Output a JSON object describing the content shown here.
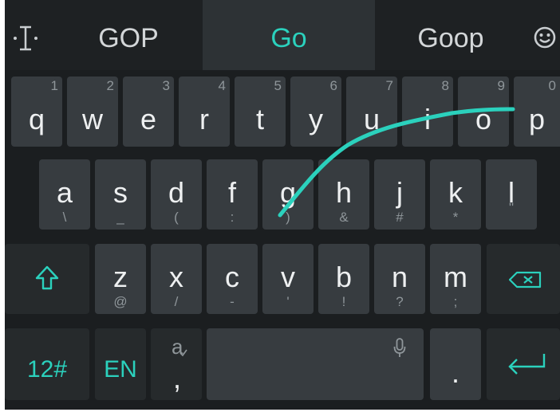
{
  "suggestions": {
    "left": "GOP",
    "center": "Go",
    "right": "Goop"
  },
  "accent_color": "#2bd1bd",
  "icons": {
    "cursor": "text-cursor-icon",
    "emoji": "emoji-icon",
    "shift": "shift-arrow-icon",
    "backspace": "backspace-icon",
    "mic": "microphone-icon",
    "enter": "enter-arrow-icon"
  },
  "rows": {
    "top": [
      {
        "main": "q",
        "hint": "1"
      },
      {
        "main": "w",
        "hint": "2"
      },
      {
        "main": "e",
        "hint": "3"
      },
      {
        "main": "r",
        "hint": "4"
      },
      {
        "main": "t",
        "hint": "5"
      },
      {
        "main": "y",
        "hint": "6"
      },
      {
        "main": "u",
        "hint": "7"
      },
      {
        "main": "i",
        "hint": "8"
      },
      {
        "main": "o",
        "hint": "9"
      },
      {
        "main": "p",
        "hint": "0"
      }
    ],
    "home": [
      {
        "main": "a",
        "hint": "\\"
      },
      {
        "main": "s",
        "hint": "_"
      },
      {
        "main": "d",
        "hint": "("
      },
      {
        "main": "f",
        "hint": ":"
      },
      {
        "main": "g",
        "hint": ")"
      },
      {
        "main": "h",
        "hint": "&"
      },
      {
        "main": "j",
        "hint": "#"
      },
      {
        "main": "k",
        "hint": "*"
      },
      {
        "main": "l",
        "hint": "\""
      }
    ],
    "bottom": [
      {
        "main": "z",
        "hint": "@"
      },
      {
        "main": "x",
        "hint": "/"
      },
      {
        "main": "c",
        "hint": "-"
      },
      {
        "main": "v",
        "hint": "'"
      },
      {
        "main": "b",
        "hint": "!"
      },
      {
        "main": "n",
        "hint": "?"
      },
      {
        "main": "m",
        "hint": ";"
      }
    ]
  },
  "function_row": {
    "symbols": "12#",
    "language": "EN",
    "alt_char": "a",
    "comma": ",",
    "period": "."
  }
}
